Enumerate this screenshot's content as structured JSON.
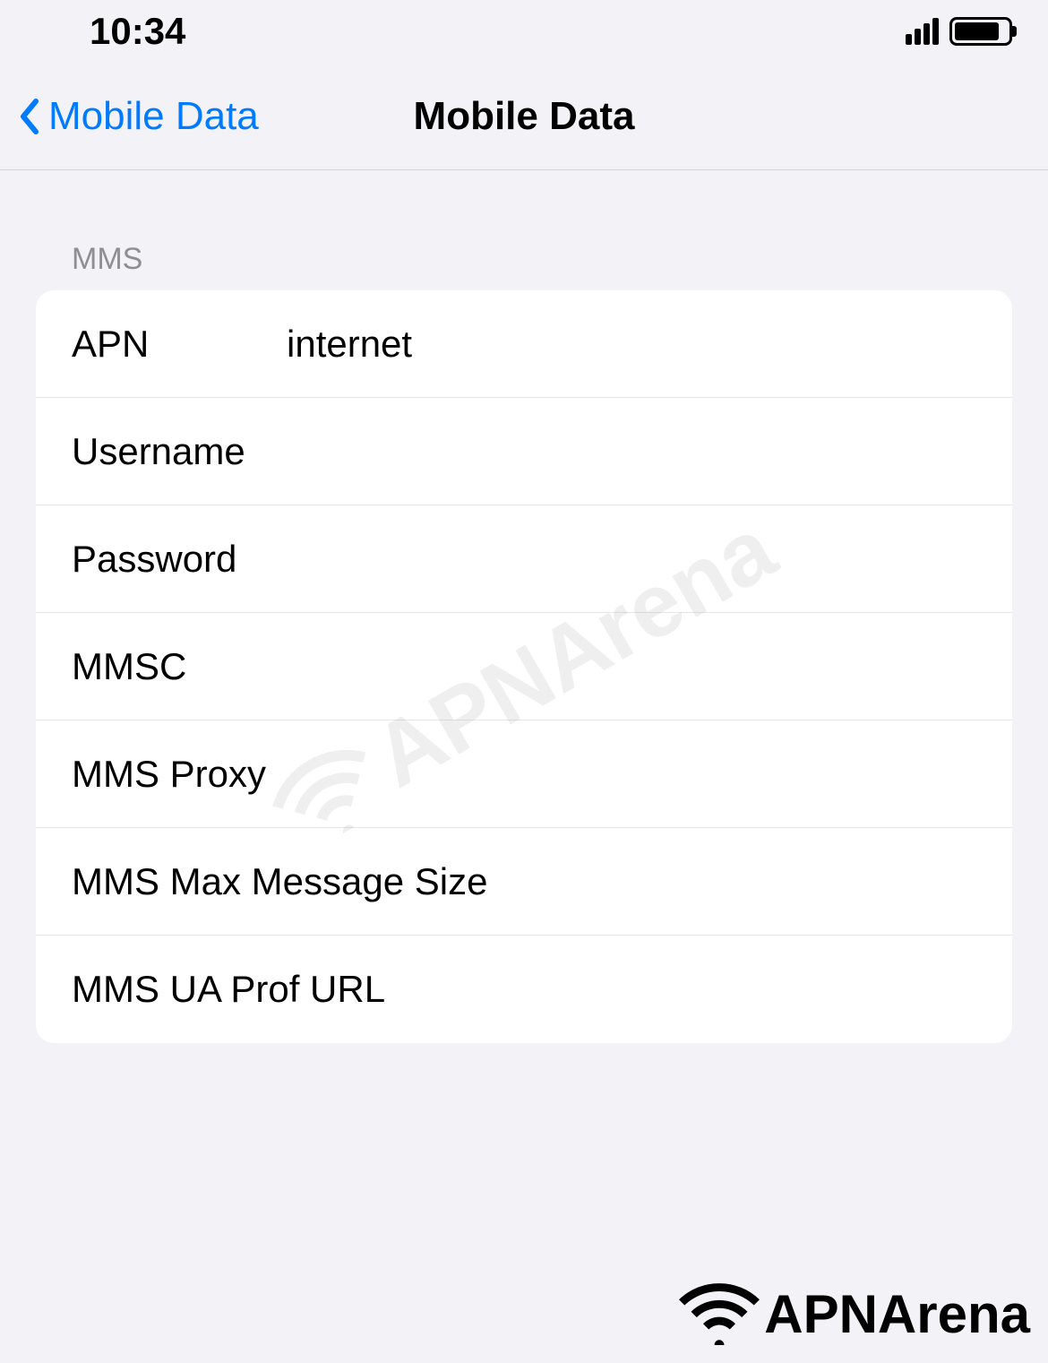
{
  "status": {
    "time": "10:34"
  },
  "nav": {
    "back_label": "Mobile Data",
    "title": "Mobile Data"
  },
  "section": {
    "header": "MMS"
  },
  "fields": {
    "apn": {
      "label": "APN",
      "value": "internet"
    },
    "username": {
      "label": "Username",
      "value": ""
    },
    "password": {
      "label": "Password",
      "value": ""
    },
    "mmsc": {
      "label": "MMSC",
      "value": ""
    },
    "mms_proxy": {
      "label": "MMS Proxy",
      "value": ""
    },
    "mms_max_size": {
      "label": "MMS Max Message Size",
      "value": ""
    },
    "mms_ua_prof": {
      "label": "MMS UA Prof URL",
      "value": ""
    }
  },
  "watermark": {
    "text": "APNArena"
  },
  "footer": {
    "text": "APNArena"
  }
}
